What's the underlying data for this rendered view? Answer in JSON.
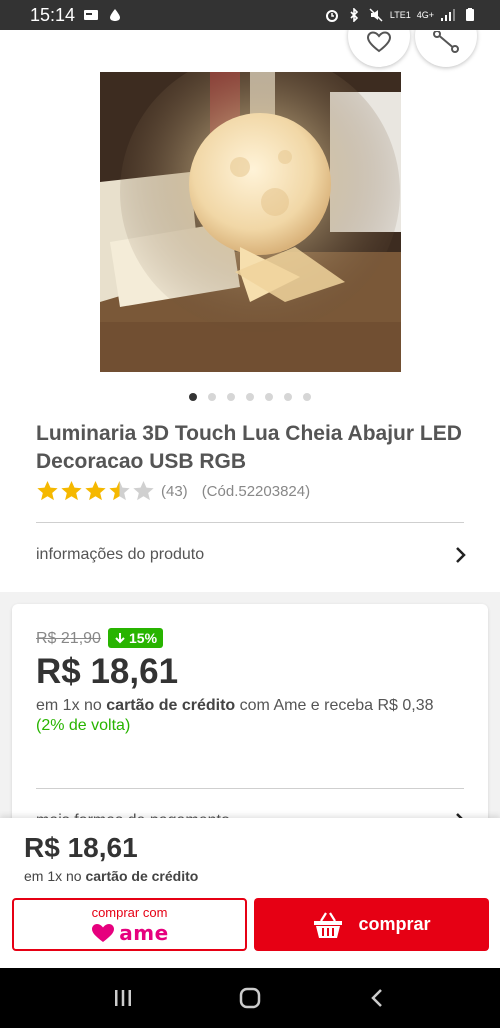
{
  "status_bar": {
    "time": "15:14",
    "network_label": "4G+",
    "carrier_label": "LTE1"
  },
  "product": {
    "title": "Luminaria 3D Touch Lua Cheia Abajur LED Decoracao USB RGB",
    "rating": 3.5,
    "rating_max": 5,
    "review_count": "(43)",
    "code": "(Cód.52203824)",
    "image_count": 7,
    "active_image": 1,
    "info_link": "informações do produto"
  },
  "pricing": {
    "old_price": "R$ 21,90",
    "discount": "15%",
    "price": "R$ 18,61",
    "installment_prefix": "em 1x no",
    "installment_bold": "cartão de crédito",
    "installment_suffix": "com Ame e receba R$ 0,38",
    "cashback": "(2% de volta)",
    "more_payment_link": "mais formas de pagamento"
  },
  "bottom_bar": {
    "price": "R$ 18,61",
    "installment_prefix": "em 1x no",
    "installment_bold": "cartão de crédito",
    "ame_button_label": "comprar com",
    "ame_logo_text": "ame",
    "buy_button_label": "comprar"
  },
  "colors": {
    "accent_red": "#e60014",
    "discount_green": "#28b400",
    "ame_pink": "#e6007e"
  },
  "icons": [
    "heart-icon",
    "share-icon",
    "chevron-right-icon",
    "arrow-down-icon",
    "basket-icon",
    "recent-apps-icon",
    "home-icon",
    "back-icon"
  ]
}
